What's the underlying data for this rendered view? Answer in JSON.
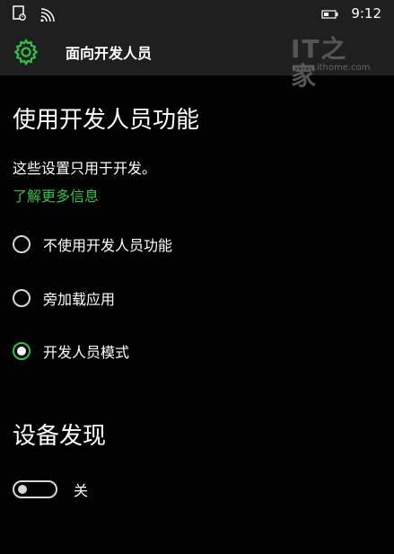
{
  "status_bar": {
    "time": "9:12",
    "icons": [
      "notification-icon",
      "wifi-icon",
      "battery-icon"
    ]
  },
  "header": {
    "title": "面向开发人员",
    "icon": "gear-icon",
    "watermark": {
      "logo": "IT之家",
      "url": "www.ithome.com"
    }
  },
  "developer_features": {
    "heading": "使用开发人员功能",
    "description": "这些设置只用于开发。",
    "learn_more": "了解更多信息",
    "options": [
      {
        "label": "不使用开发人员功能",
        "selected": false
      },
      {
        "label": "旁加载应用",
        "selected": false
      },
      {
        "label": "开发人员模式",
        "selected": true
      }
    ]
  },
  "device_discovery": {
    "heading": "设备发现",
    "toggle_state": "关",
    "toggle_on": false
  },
  "colors": {
    "accent": "#33c146",
    "background": "#000000",
    "bar": "#1f1f1f"
  }
}
